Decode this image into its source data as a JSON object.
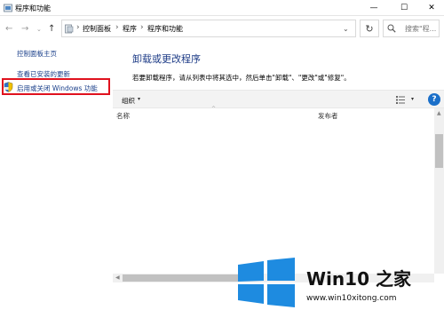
{
  "window": {
    "title": "程序和功能",
    "minimize": "—",
    "maximize": "☐",
    "close": "✕"
  },
  "nav": {
    "back": "←",
    "forward": "→",
    "recent": "⌄",
    "up": "↑",
    "refresh": "↻"
  },
  "address": {
    "sep1": "›",
    "crumb1": "控制面板",
    "sep2": "›",
    "crumb2": "程序",
    "sep3": "›",
    "crumb3": "程序和功能",
    "dropdown": "⌄"
  },
  "search": {
    "placeholder": "搜索\"程...",
    "icon": "search-icon"
  },
  "sidebar": {
    "home": "控制面板主页",
    "installed_updates": "查看已安装的更新",
    "windows_features": "启用或关闭 Windows 功能"
  },
  "main": {
    "heading": "卸载或更改程序",
    "description": "若要卸载程序，请从列表中将其选中，然后单击\"卸载\"、\"更改\"或\"修复\"。"
  },
  "toolbar": {
    "organize": "组织",
    "organize_caret": "▾",
    "view_caret": "▾",
    "help": "?"
  },
  "columns": {
    "name": "名称",
    "sort_indicator": "^",
    "publisher": "发布者"
  },
  "scroll": {
    "up": "▲",
    "left": "◀"
  },
  "watermark": {
    "title": "Win10 之家",
    "url": "www.win10xitong.com"
  },
  "colors": {
    "link": "#1a3f8a",
    "heading": "#1e3c87",
    "highlight_border": "#e0121e",
    "logo_blue": "#1e8be0",
    "help_blue": "#1a6fc9"
  }
}
